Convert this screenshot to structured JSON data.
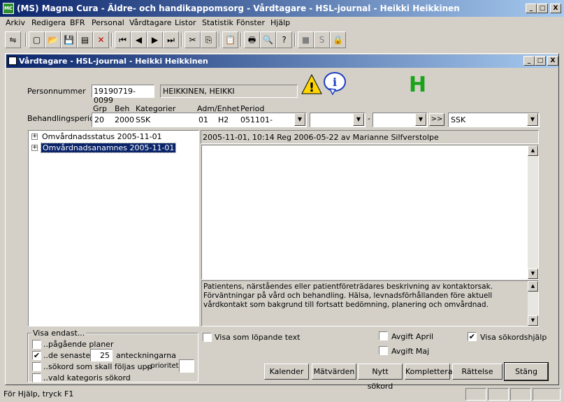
{
  "app": {
    "title": "(MS) Magna Cura - Äldre- och handikappomsorg - Vårdtagare - HSL-journal - Heikki Heikkinen",
    "icon_text": "MC"
  },
  "window_buttons": {
    "min": "_",
    "max": "□",
    "close": "X"
  },
  "menu": [
    "Arkiv",
    "Redigera",
    "BFR",
    "Personal",
    "Vårdtagare",
    "Listor",
    "Statistik",
    "Fönster",
    "Hjälp"
  ],
  "toolbar": {
    "icons": [
      "import-icon",
      "new-document-icon",
      "open-folder-icon",
      "save-icon",
      "print-preview-icon",
      "delete-icon",
      "first-record-icon",
      "previous-record-icon",
      "next-record-icon",
      "last-record-icon",
      "cut-icon",
      "copy-icon",
      "paste-icon",
      "print-icon",
      "preview-icon",
      "help-icon",
      "stop-icon",
      "s-icon",
      "lock-icon"
    ],
    "glyphs": [
      "⇋",
      "▢",
      "📂",
      "💾",
      "▤",
      "✕",
      "⏮",
      "◀",
      "▶",
      "⏭",
      "✂",
      "⎘",
      "📋",
      "🖶",
      "🔍",
      "?",
      "■",
      "S",
      "🔒"
    ]
  },
  "child": {
    "title": "Vårdtagare - HSL-journal - Heikki Heikkinen"
  },
  "patient": {
    "personnummer_label": "Personnummer",
    "personnummer": "19190719-0099",
    "name": "HEIKKINEN, HEIKKI",
    "warning_glyph": "!",
    "info_glyph": "i",
    "h_mark": "H",
    "h_color": "#1aa31a"
  },
  "behandling": {
    "label": "Behandlingsperiod",
    "headers": {
      "grp": "Grp",
      "beh": "Beh",
      "kategorier": "Kategorier",
      "adm": "Adm/Enhet",
      "period": "Period"
    },
    "grp": "20",
    "beh": "2000",
    "kategori": "SSK",
    "adm": "01",
    "enhet": "H2",
    "period": "051101-",
    "date_separator": "-",
    "forward_btn": ">>",
    "ssk": "SSK"
  },
  "tree": {
    "items": [
      {
        "label": "Omvårdnadsstatus  2005-11-01",
        "selected": false
      },
      {
        "label": "Omvårdnadsanamnes  2005-11-01",
        "selected": true
      }
    ],
    "expander": "+"
  },
  "note": {
    "header": "2005-11-01, 10:14      Reg 2006-05-22 av Marianne Silfverstolpe",
    "body": "",
    "help": "Patientens, närståendes eller patientföreträdares beskrivning av kontaktorsak. Förväntningar på vård och behandling. Hälsa, levnadsförhållanden före aktuell vårdkontakt som bakgrund till fortsatt bedömning, planering och omvårdnad."
  },
  "visa": {
    "title": "Visa endast...",
    "pagaende": "..pågående planer",
    "senaste": "..de senaste",
    "senaste_count": "25",
    "anteckningarna": "anteckningarna",
    "sokord": "..sökord som skall följas upp",
    "prioritet": "..prioritet",
    "prioritet_value": "",
    "kategori": "..vald kategoris sökord"
  },
  "options": {
    "lopande": "Visa som löpande text",
    "avgift_april": "Avgift April",
    "avgift_maj": "Avgift Maj",
    "sokordshjalp": "Visa sökordshjälp",
    "check": "✔"
  },
  "buttons": {
    "kalender": "Kalender",
    "matvarden": "Mätvärden",
    "nytt_sokord": "Nytt sökord",
    "komplettera": "Komplettera",
    "rattelse": "Rättelse",
    "stang": "Stäng"
  },
  "status": {
    "text": "För Hjälp, tryck F1"
  }
}
